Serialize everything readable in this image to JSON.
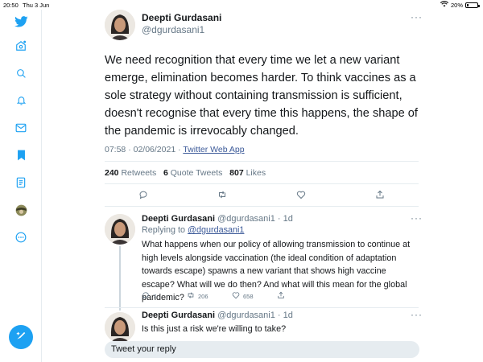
{
  "status_bar": {
    "time": "20:50",
    "date": "Thu 3 Jun",
    "battery": "20%",
    "battery_level": 0.2
  },
  "sidebar": {
    "items": [
      {
        "icon": "twitter-bird-icon"
      },
      {
        "icon": "home-icon"
      },
      {
        "icon": "search-icon"
      },
      {
        "icon": "notifications-bell-icon"
      },
      {
        "icon": "messages-envelope-icon"
      },
      {
        "icon": "bookmark-icon"
      },
      {
        "icon": "lists-icon"
      },
      {
        "icon": "profile-avatar-icon"
      },
      {
        "icon": "more-icon"
      }
    ],
    "compose_icon": "compose-tweet-icon",
    "accent": "#1da1f2"
  },
  "tweet": {
    "name": "Deepti Gurdasani",
    "handle": "@dgurdasani1",
    "more": "···",
    "text": "We need recognition that every time we let a new variant emerge, elimination becomes harder. To think vaccines as a sole strategy without containing transmission is sufficient, doesn't recognise that every time this happens, the shape of the pandemic is irrevocably changed.",
    "timestamp": "07:58 · 02/06/2021 ·",
    "source": "Twitter Web App",
    "retweets": "240",
    "retweets_label": "Retweets",
    "quotes": "6",
    "quotes_label": "Quote Tweets",
    "likes": "807",
    "likes_label": "Likes"
  },
  "replies": [
    {
      "name": "Deepti Gurdasani",
      "handle_time": "@dgurdasani1 · 1d",
      "replying_prefix": "Replying to",
      "replying_to": "@dgurdasani1",
      "text": "What happens when our policy of allowing transmission to continue at high levels alongside vaccination (the ideal condition of adaptation towards escape) spawns a new variant that shows high vaccine escape? What will we do then? And what will this mean for the global pandemic?",
      "reply_count": "7",
      "retweet_count": "206",
      "like_count": "658",
      "more": "···"
    },
    {
      "name": "Deepti Gurdasani",
      "handle_time": "@dgurdasani1 · 1d",
      "text": "Is this just a risk we're willing to take?",
      "more": "···"
    }
  ],
  "reply_box": {
    "placeholder": "Tweet your reply"
  },
  "colors": {
    "brand": "#1da1f2",
    "text": "#14171a",
    "secondary": "#657786",
    "link": "#3b5998"
  }
}
